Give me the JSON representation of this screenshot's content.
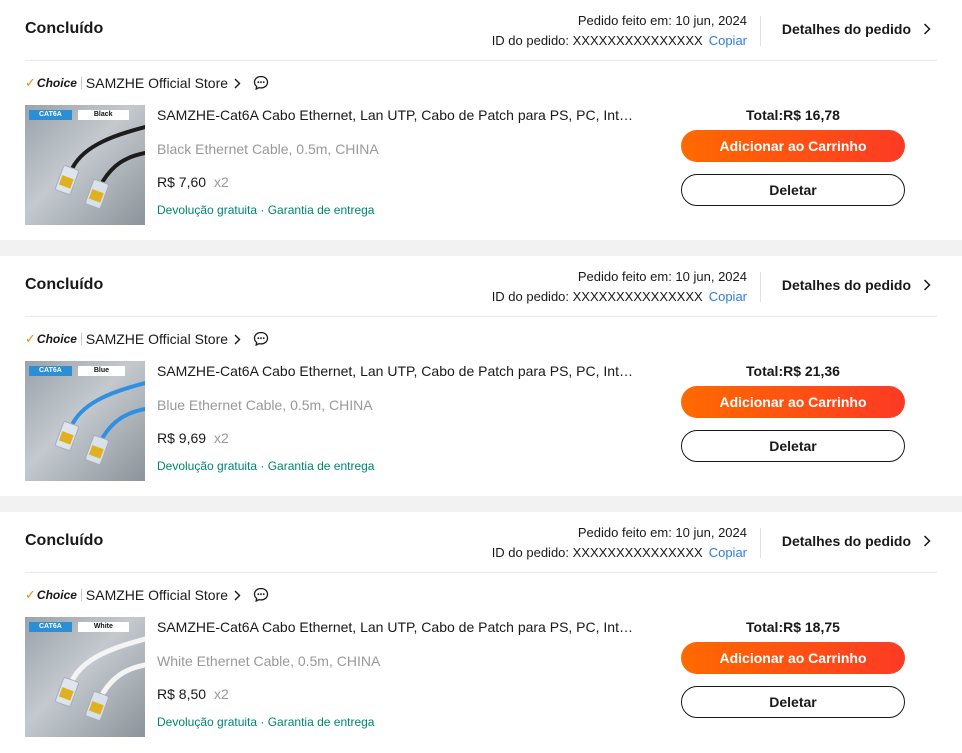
{
  "colors": {
    "accent_orange": "#fd4c16",
    "link_blue": "#2e7de1",
    "perk_green": "#00856f",
    "muted_gray": "#999999",
    "choice_check": "#fd7e14"
  },
  "orders": [
    {
      "status": "Concluído",
      "order_date": "Pedido feito em: 10 jun, 2024",
      "order_id": "ID do pedido: XXXXXXXXXXXXXXX",
      "copy_label": "Copiar",
      "details_label": "Detalhes do pedido",
      "choice_label": "Choice",
      "store_name": "SAMZHE Official Store",
      "thumb_cat": "CAT6A",
      "thumb_color": "Black",
      "cable_color": "#1c1c1c",
      "product_title": "SAMZHE-Cat6A Cabo Ethernet, Lan UTP, Cabo de Patch para PS, PC, Internet, Modem, Roteador",
      "variant": "Black Ethernet Cable, 0.5m, CHINA",
      "price": "R$ 7,60",
      "qty": "x2",
      "perks": "Devolução gratuita · Garantia de entrega",
      "total": "Total:R$ 16,78",
      "cart_label": "Adicionar ao Carrinho",
      "delete_label": "Deletar"
    },
    {
      "status": "Concluído",
      "order_date": "Pedido feito em: 10 jun, 2024",
      "order_id": "ID do pedido: XXXXXXXXXXXXXXX",
      "copy_label": "Copiar",
      "details_label": "Detalhes do pedido",
      "choice_label": "Choice",
      "store_name": "SAMZHE Official Store",
      "thumb_cat": "CAT6A",
      "thumb_color": "Blue",
      "cable_color": "#2f8fe0",
      "product_title": "SAMZHE-Cat6A Cabo Ethernet, Lan UTP, Cabo de Patch para PS, PC, Internet, Modem, Roteador",
      "variant": "Blue Ethernet Cable, 0.5m, CHINA",
      "price": "R$ 9,69",
      "qty": "x2",
      "perks": "Devolução gratuita · Garantia de entrega",
      "total": "Total:R$ 21,36",
      "cart_label": "Adicionar ao Carrinho",
      "delete_label": "Deletar"
    },
    {
      "status": "Concluído",
      "order_date": "Pedido feito em: 10 jun, 2024",
      "order_id": "ID do pedido: XXXXXXXXXXXXXXX",
      "copy_label": "Copiar",
      "details_label": "Detalhes do pedido",
      "choice_label": "Choice",
      "store_name": "SAMZHE Official Store",
      "thumb_cat": "CAT6A",
      "thumb_color": "White",
      "cable_color": "#f4f4f4",
      "product_title": "SAMZHE-Cat6A Cabo Ethernet, Lan UTP, Cabo de Patch para PS, PC, Internet, Modem, Roteador",
      "variant": "White Ethernet Cable, 0.5m, CHINA",
      "price": "R$ 8,50",
      "qty": "x2",
      "perks": "Devolução gratuita · Garantia de entrega",
      "total": "Total:R$ 18,75",
      "cart_label": "Adicionar ao Carrinho",
      "delete_label": "Deletar"
    }
  ]
}
